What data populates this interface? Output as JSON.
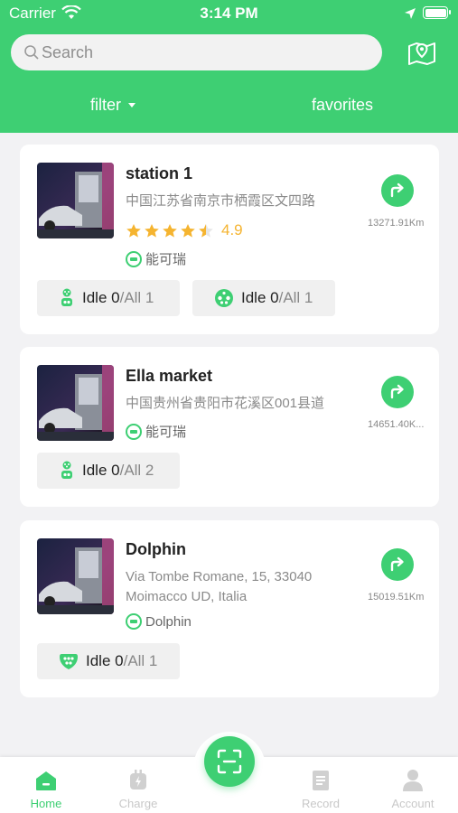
{
  "status": {
    "carrier": "Carrier",
    "time": "3:14 PM"
  },
  "search": {
    "placeholder": "Search"
  },
  "tabs": {
    "filter": "filter",
    "favorites": "favorites"
  },
  "stations": [
    {
      "name": "station 1",
      "address": "中国江苏省南京市栖霞区文四路",
      "rating": "4.9",
      "stars": 4.5,
      "operator": "能可瑞",
      "distance": "13271.91Km",
      "chips": [
        {
          "icon": "connector-icon",
          "idle_label": "Idle 0",
          "all_label": "/All 1"
        },
        {
          "icon": "gb-connector-icon",
          "idle_label": "Idle 0",
          "all_label": "/All 1"
        }
      ]
    },
    {
      "name": "Ella market",
      "address": "中国贵州省贵阳市花溪区001县道",
      "operator": "能可瑞",
      "distance": "14651.40K...",
      "chips": [
        {
          "icon": "connector-icon",
          "idle_label": "Idle 0",
          "all_label": "/All 2"
        }
      ]
    },
    {
      "name": "Dolphin",
      "address": "Via Tombe Romane, 15, 33040 Moimacco UD, Italia",
      "operator": "Dolphin",
      "distance": "15019.51Km",
      "chips": [
        {
          "icon": "type2-connector-icon",
          "idle_label": "Idle 0",
          "all_label": "/All 1"
        }
      ]
    }
  ],
  "tabbar": {
    "home": "Home",
    "charge": "Charge",
    "record": "Record",
    "account": "Account"
  },
  "colors": {
    "accent": "#3ecf73",
    "star": "#f5b430"
  }
}
